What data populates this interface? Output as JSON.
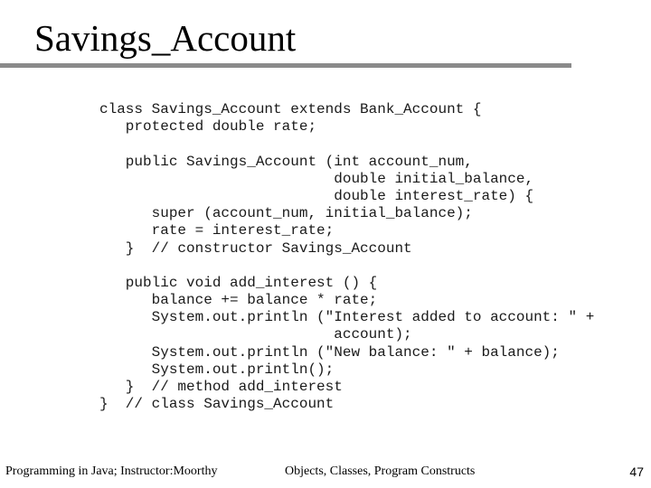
{
  "slide": {
    "title": "Savings_Account",
    "code_lines": [
      "class Savings_Account extends Bank_Account {",
      "   protected double rate;",
      "",
      "   public Savings_Account (int account_num,",
      "                           double initial_balance,",
      "                           double interest_rate) {",
      "      super (account_num, initial_balance);",
      "      rate = interest_rate;",
      "   }  // constructor Savings_Account",
      "",
      "   public void add_interest () {",
      "      balance += balance * rate;",
      "      System.out.println (\"Interest added to account: \" +",
      "                           account);",
      "      System.out.println (\"New balance: \" + balance);",
      "      System.out.println();",
      "   }  // method add_interest",
      "}  // class Savings_Account"
    ]
  },
  "footer": {
    "course": "Programming in Java; Instructor:Moorthy",
    "topic": "Objects, Classes, Program Constructs",
    "page_number": "47"
  }
}
